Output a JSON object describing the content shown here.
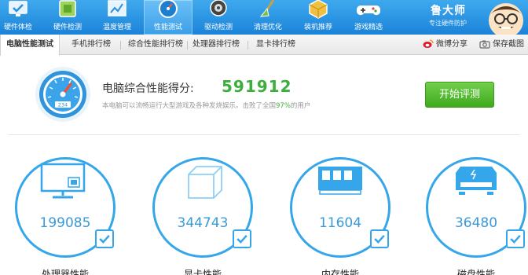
{
  "toolbar": {
    "items": [
      {
        "label": "硬件体检",
        "icon": "monitor-check-icon"
      },
      {
        "label": "硬件检测",
        "icon": "chip-icon"
      },
      {
        "label": "温度管理",
        "icon": "temperature-chart-icon"
      },
      {
        "label": "性能测试",
        "icon": "speedometer-icon",
        "active": true
      },
      {
        "label": "驱动检测",
        "icon": "gear-shield-icon"
      },
      {
        "label": "清理优化",
        "icon": "broom-icon"
      },
      {
        "label": "装机推荐",
        "icon": "box-icon"
      },
      {
        "label": "游戏精选",
        "icon": "gamepad-icon"
      }
    ]
  },
  "brand": {
    "name": "鲁大师",
    "tagline": "专注硬件防护"
  },
  "subtabs": {
    "items": [
      {
        "label": "电脑性能测试",
        "active": true
      },
      {
        "label": "手机排行榜"
      },
      {
        "label": "综合性能排行榜"
      },
      {
        "label": "处理器排行榜"
      },
      {
        "label": "显卡排行榜"
      }
    ],
    "share_weibo": "微博分享",
    "save_screenshot": "保存截图"
  },
  "score": {
    "title": "电脑综合性能得分:",
    "value": "591912",
    "desc_prefix": "本电脑可以流畅运行大型游戏及各种发烧娱乐。击败了全国",
    "percent": "97%",
    "desc_suffix": "的用户",
    "gauge_readout": "234",
    "start_button": "开始评测"
  },
  "components": [
    {
      "label": "处理器性能",
      "value": "199085",
      "icon": "cpu-monitor-icon"
    },
    {
      "label": "显卡性能",
      "value": "344743",
      "icon": "cube-icon"
    },
    {
      "label": "内存性能",
      "value": "11604",
      "icon": "memory-icon"
    },
    {
      "label": "磁盘性能",
      "value": "36480",
      "icon": "disk-icon"
    }
  ],
  "colors": {
    "toolbar_blue": "#1b83d8",
    "accent_blue": "#35a6ea",
    "score_green": "#3cae3c",
    "button_green": "#4cb328"
  }
}
